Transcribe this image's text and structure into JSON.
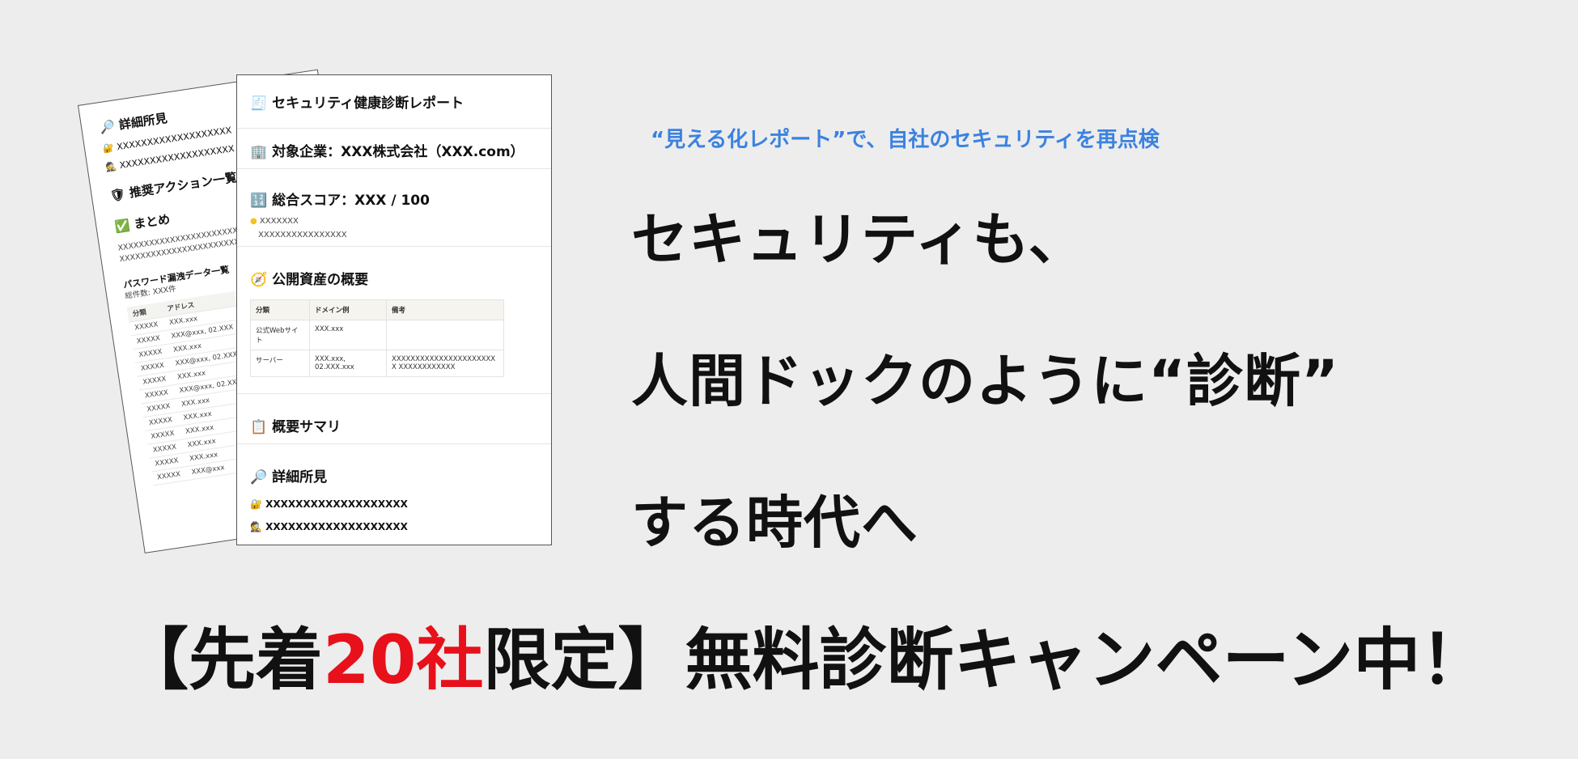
{
  "back_doc": {
    "detail_heading": "詳細所見",
    "detail_item_1": "XXXXXXXXXXXXXXXXXXX",
    "detail_item_2": "XXXXXXXXXXXXXXXXXXX",
    "actions_heading": "推奨アクション一覧",
    "summary_heading": "まとめ",
    "summary_line_1": "XXXXXXXXXXXXXXXXXXXXXXXXXXXXXXX",
    "summary_line_2": "XXXXXXXXXXXXXXXXXXXXXXXXXXXXXXX",
    "leak_heading": "パスワード漏洩データ一覧",
    "leak_count": "総件数: XXX件",
    "table_headers": [
      "分類",
      "アドレス"
    ],
    "table_rows": [
      [
        "XXXXX",
        "XXX.xxx"
      ],
      [
        "XXXXX",
        "XXX@xxx, 02.XXX"
      ],
      [
        "XXXXX",
        "XXX.xxx"
      ],
      [
        "XXXXX",
        "XXX@xxx, 02.XXX"
      ],
      [
        "XXXXX",
        "XXX.xxx"
      ],
      [
        "XXXXX",
        "XXX@xxx, 02.XXX"
      ],
      [
        "XXXXX",
        "XXX.xxx"
      ],
      [
        "XXXXX",
        "XXX.xxx"
      ],
      [
        "XXXXX",
        "XXX.xxx"
      ],
      [
        "XXXXX",
        "XXX.xxx"
      ],
      [
        "XXXXX",
        "XXX.xxx"
      ],
      [
        "XXXXX",
        "XXX@xxx"
      ]
    ]
  },
  "front_doc": {
    "title": "セキュリティ健康診断レポート",
    "company": "対象企業：XXX株式会社（XXX.com）",
    "score": "総合スコア：XXX / 100",
    "score_item": "XXXXXXX",
    "score_detail": "XXXXXXXXXXXXXXXX",
    "assets_heading": "公開資産の概要",
    "assets_headers": [
      "分類",
      "ドメイン例",
      "備考"
    ],
    "assets_rows": [
      [
        "公式Webサイト",
        "XXX.xxx",
        ""
      ],
      [
        "サーバー",
        "XXX.xxx, 02.XXX.xxx",
        "XXXXXXXXXXXXXXXXXXXXXXX XXXXXXXXXXXX"
      ]
    ],
    "overview_heading": "概要サマリ",
    "detail_heading": "詳細所見",
    "detail_item_1": "XXXXXXXXXXXXXXXXXXX",
    "detail_item_2": "XXXXXXXXXXXXXXXXXXX"
  },
  "tagline": "“見える化レポート”で、自社のセキュリティを再点検",
  "headline_1": "セキュリティも、",
  "headline_2": "人間ドックのように“診断”",
  "headline_3": "する時代へ",
  "bottom_pre": "【先着",
  "bottom_red": "20社",
  "bottom_post": "限定】無料診断キャンペーン中！",
  "colors": {
    "accent_blue": "#3b82e0",
    "accent_red": "#e8101a",
    "background": "#ededed"
  }
}
